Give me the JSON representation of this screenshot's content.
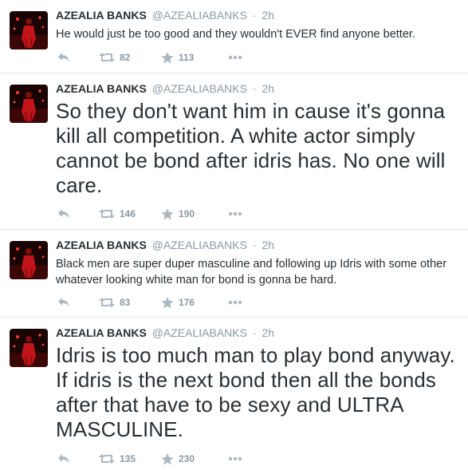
{
  "colors": {
    "text": "#292f33",
    "muted": "#8899a6",
    "icon": "#aab8c2",
    "divider": "#e1e8ed",
    "avatar_bg": "#1a0303",
    "avatar_accent": "#c3141a"
  },
  "icons": {
    "reply": "reply-icon",
    "retweet": "retweet-icon",
    "favorite": "star-icon",
    "more": "more-dots-icon"
  },
  "tweets": [
    {
      "fullname": "AZEALIA BANKS",
      "username": "@AZEALIABANKS",
      "dot": "·",
      "time": "2h",
      "text": "He would just be too good and they wouldn't EVER find anyone better.",
      "retweets": "82",
      "favorites": "113"
    },
    {
      "fullname": "AZEALIA BANKS",
      "username": "@AZEALIABANKS",
      "dot": "·",
      "time": "2h",
      "text": "So they don't want him in cause it's gonna kill all competition. A white actor simply cannot be bond after idris has. No one will care.",
      "retweets": "146",
      "favorites": "190"
    },
    {
      "fullname": "AZEALIA BANKS",
      "username": "@AZEALIABANKS",
      "dot": "·",
      "time": "2h",
      "text": "Black men are super duper masculine and following up Idris with some other whatever looking white man for bond is gonna be hard.",
      "retweets": "83",
      "favorites": "176"
    },
    {
      "fullname": "AZEALIA BANKS",
      "username": "@AZEALIABANKS",
      "dot": "·",
      "time": "2h",
      "text": "Idris is too much man to play bond anyway. If idris is the next bond then all the bonds after that have to be sexy and ULTRA MASCULINE.",
      "retweets": "135",
      "favorites": "230"
    }
  ]
}
